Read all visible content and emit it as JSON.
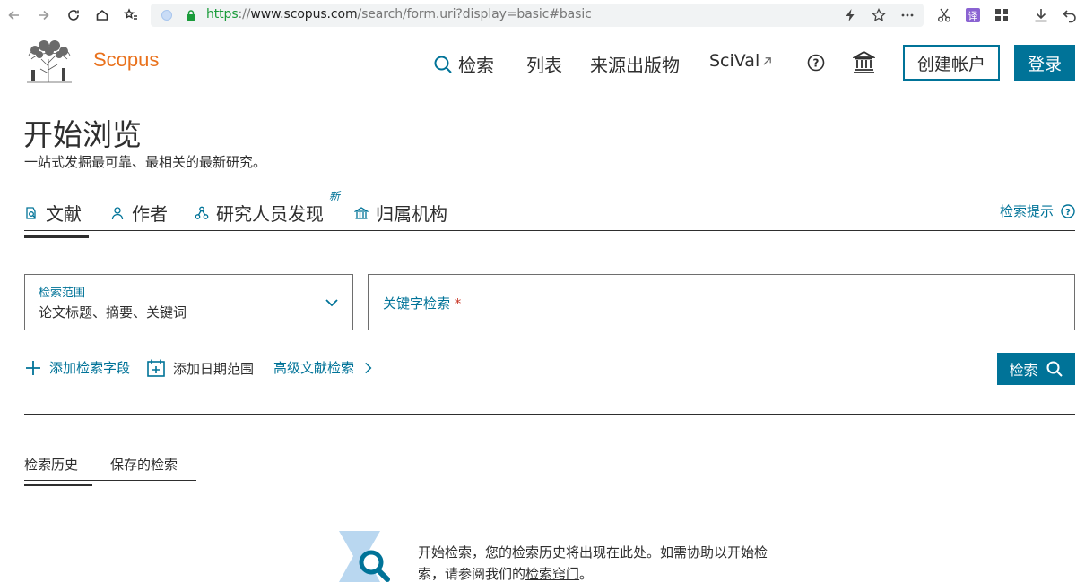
{
  "browser": {
    "url_proto": "https",
    "url_sep": "://",
    "url_host": "www.scopus.com",
    "url_path": "/search/form.uri?display=basic#basic"
  },
  "header": {
    "brand": "Scopus",
    "nav_search": "检索",
    "nav_lists": "列表",
    "nav_sources": "来源出版物",
    "nav_scival": "SciVal",
    "create_account": "创建帐户",
    "login": "登录"
  },
  "page": {
    "title": "开始浏览",
    "subtitle": "一站式发掘最可靠、最相关的最新研究。"
  },
  "tabs": {
    "documents": "文献",
    "authors": "作者",
    "researcher_discovery": "研究人员发现",
    "new_badge": "新",
    "affiliations": "归属机构",
    "search_tips": "检索提示"
  },
  "search": {
    "scope_label": "检索范围",
    "scope_value": "论文标题、摘要、关键词",
    "keyword_placeholder": "关键字检索",
    "required_mark": "*",
    "add_field": "添加检索字段",
    "add_date": "添加日期范围",
    "advanced": "高级文献检索",
    "search_button": "检索"
  },
  "history": {
    "tab_history": "检索历史",
    "tab_saved": "保存的检索",
    "empty_text_1": "开始检索，您的检索历史将出现在此处。如需协助以开始检索，请参阅我们的",
    "empty_link": "检索窍门",
    "empty_text_2": "。"
  },
  "colors": {
    "accent": "#007398",
    "brand_orange": "#e9711c",
    "text": "#2e2e2e"
  }
}
